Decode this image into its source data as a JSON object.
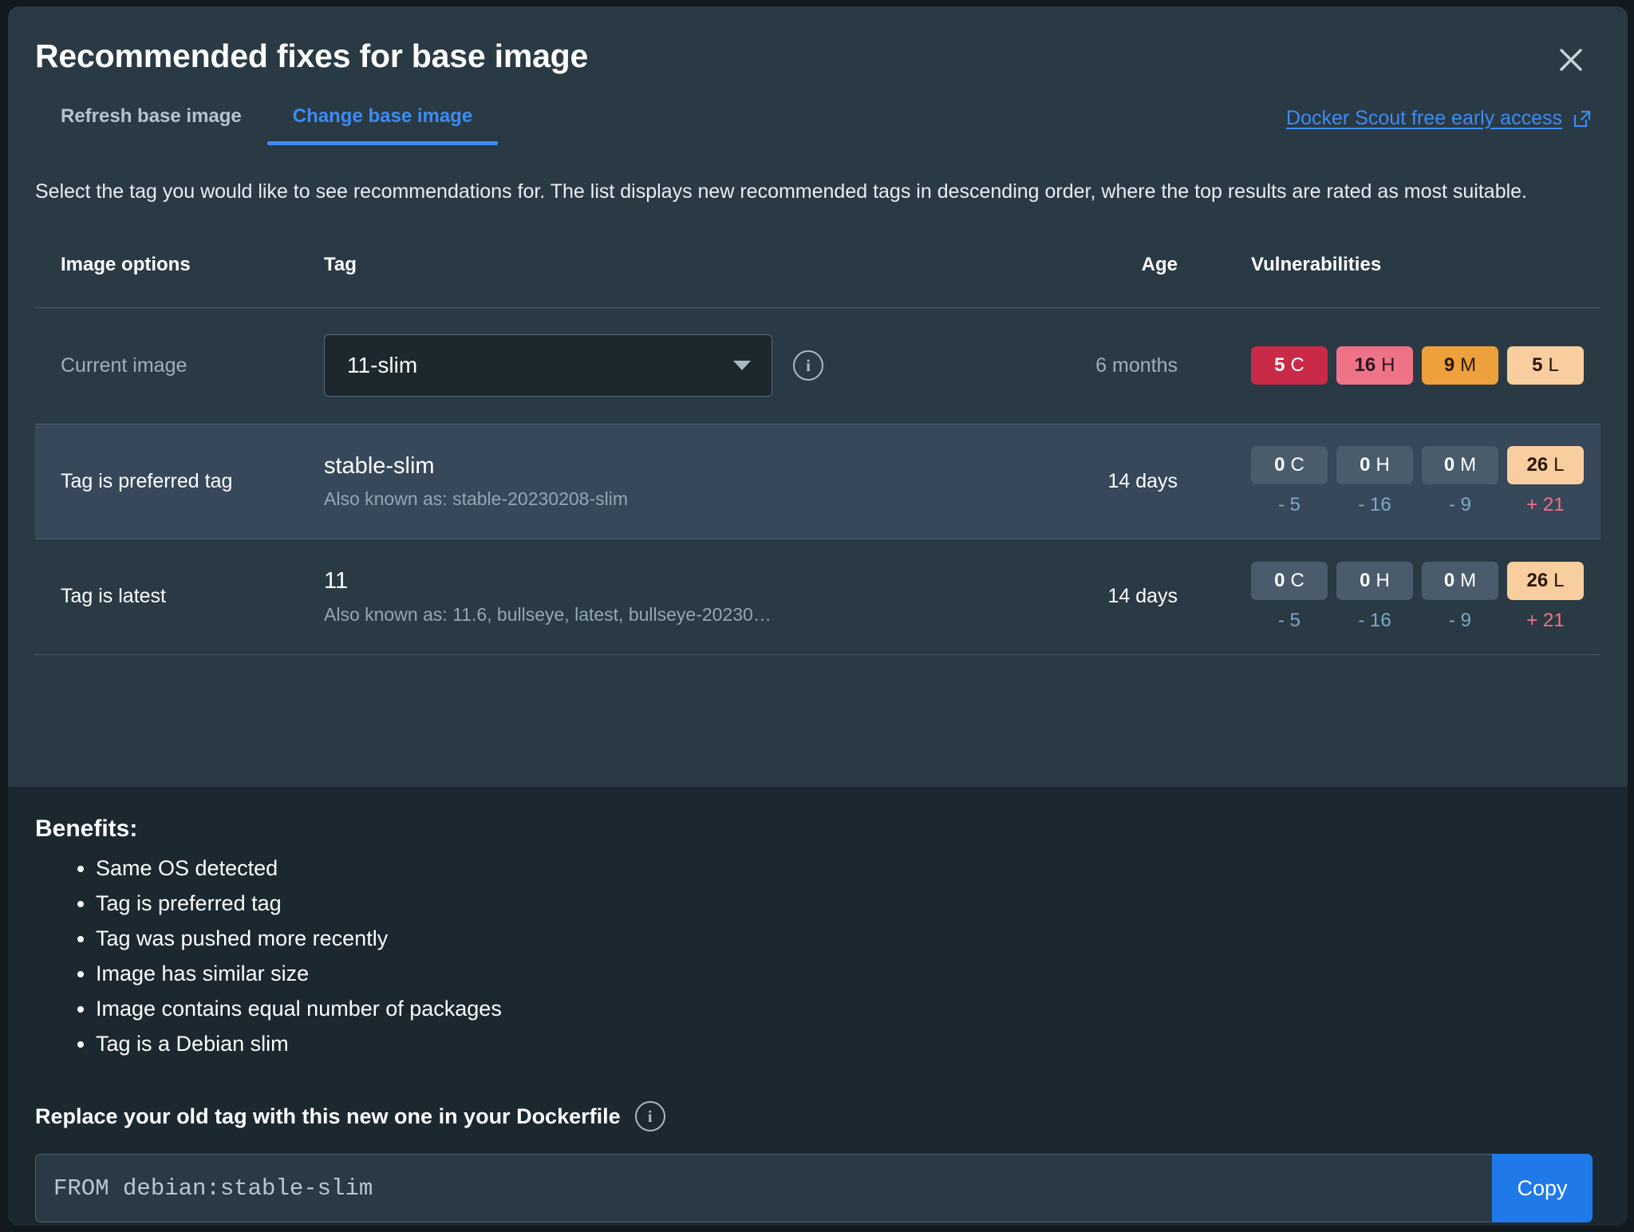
{
  "dialog": {
    "title": "Recommended fixes for base image",
    "close_icon": "close-icon"
  },
  "tabs": [
    {
      "label": "Refresh base image",
      "active": false
    },
    {
      "label": "Change base image",
      "active": true
    }
  ],
  "external_link": {
    "label": "Docker Scout free early access",
    "icon": "external-link-icon"
  },
  "description": "Select the tag you would like to see recommendations for. The list displays new recommended tags in descending order, where the top results are rated as most suitable.",
  "table": {
    "headers": {
      "options": "Image options",
      "tag": "Tag",
      "age": "Age",
      "vulnerabilities": "Vulnerabilities"
    },
    "current_row": {
      "option_label": "Current image",
      "select_value": "11-slim",
      "info_icon": "info-icon",
      "age": "6 months",
      "badges": [
        {
          "count": "5",
          "severity": "C",
          "kind": "c"
        },
        {
          "count": "16",
          "severity": "H",
          "kind": "h"
        },
        {
          "count": "9",
          "severity": "M",
          "kind": "m"
        },
        {
          "count": "5",
          "severity": "L",
          "kind": "l"
        }
      ]
    },
    "rows": [
      {
        "option_label": "Tag is preferred tag",
        "tag": "stable-slim",
        "alias": "Also known as: stable-20230208-slim",
        "age": "14 days",
        "selected": true,
        "badges": [
          {
            "count": "0",
            "severity": "C",
            "kind": "zero"
          },
          {
            "count": "0",
            "severity": "H",
            "kind": "zero"
          },
          {
            "count": "0",
            "severity": "M",
            "kind": "zero"
          },
          {
            "count": "26",
            "severity": "L",
            "kind": "l"
          }
        ],
        "deltas": [
          {
            "value": "- 5",
            "direction": "down"
          },
          {
            "value": "- 16",
            "direction": "down"
          },
          {
            "value": "- 9",
            "direction": "down"
          },
          {
            "value": "+ 21",
            "direction": "up"
          }
        ]
      },
      {
        "option_label": "Tag is latest",
        "tag": "11",
        "alias": "Also known as: 11.6, bullseye, latest, bullseye-20230…",
        "age": "14 days",
        "selected": false,
        "badges": [
          {
            "count": "0",
            "severity": "C",
            "kind": "zero"
          },
          {
            "count": "0",
            "severity": "H",
            "kind": "zero"
          },
          {
            "count": "0",
            "severity": "M",
            "kind": "zero"
          },
          {
            "count": "26",
            "severity": "L",
            "kind": "l"
          }
        ],
        "deltas": [
          {
            "value": "- 5",
            "direction": "down"
          },
          {
            "value": "- 16",
            "direction": "down"
          },
          {
            "value": "- 9",
            "direction": "down"
          },
          {
            "value": "+ 21",
            "direction": "up"
          }
        ]
      }
    ]
  },
  "benefits": {
    "title": "Benefits:",
    "items": [
      "Same OS detected",
      "Tag is preferred tag",
      "Tag was pushed more recently",
      "Image has similar size",
      "Image contains equal number of packages",
      "Tag is a Debian slim"
    ]
  },
  "replace": {
    "label": "Replace your old tag with this new one in your Dockerfile",
    "info_icon": "info-icon",
    "code": "FROM debian:stable-slim",
    "copy_label": "Copy"
  },
  "colors": {
    "accent": "#3d8bf2",
    "copy_button": "#2079e8",
    "critical": "#c92a47",
    "high": "#ef7388",
    "medium": "#eda03c",
    "low": "#f8ce9f",
    "zero": "#4a5c6c",
    "delta_down": "#7ea9c4",
    "delta_up": "#ef7388"
  }
}
